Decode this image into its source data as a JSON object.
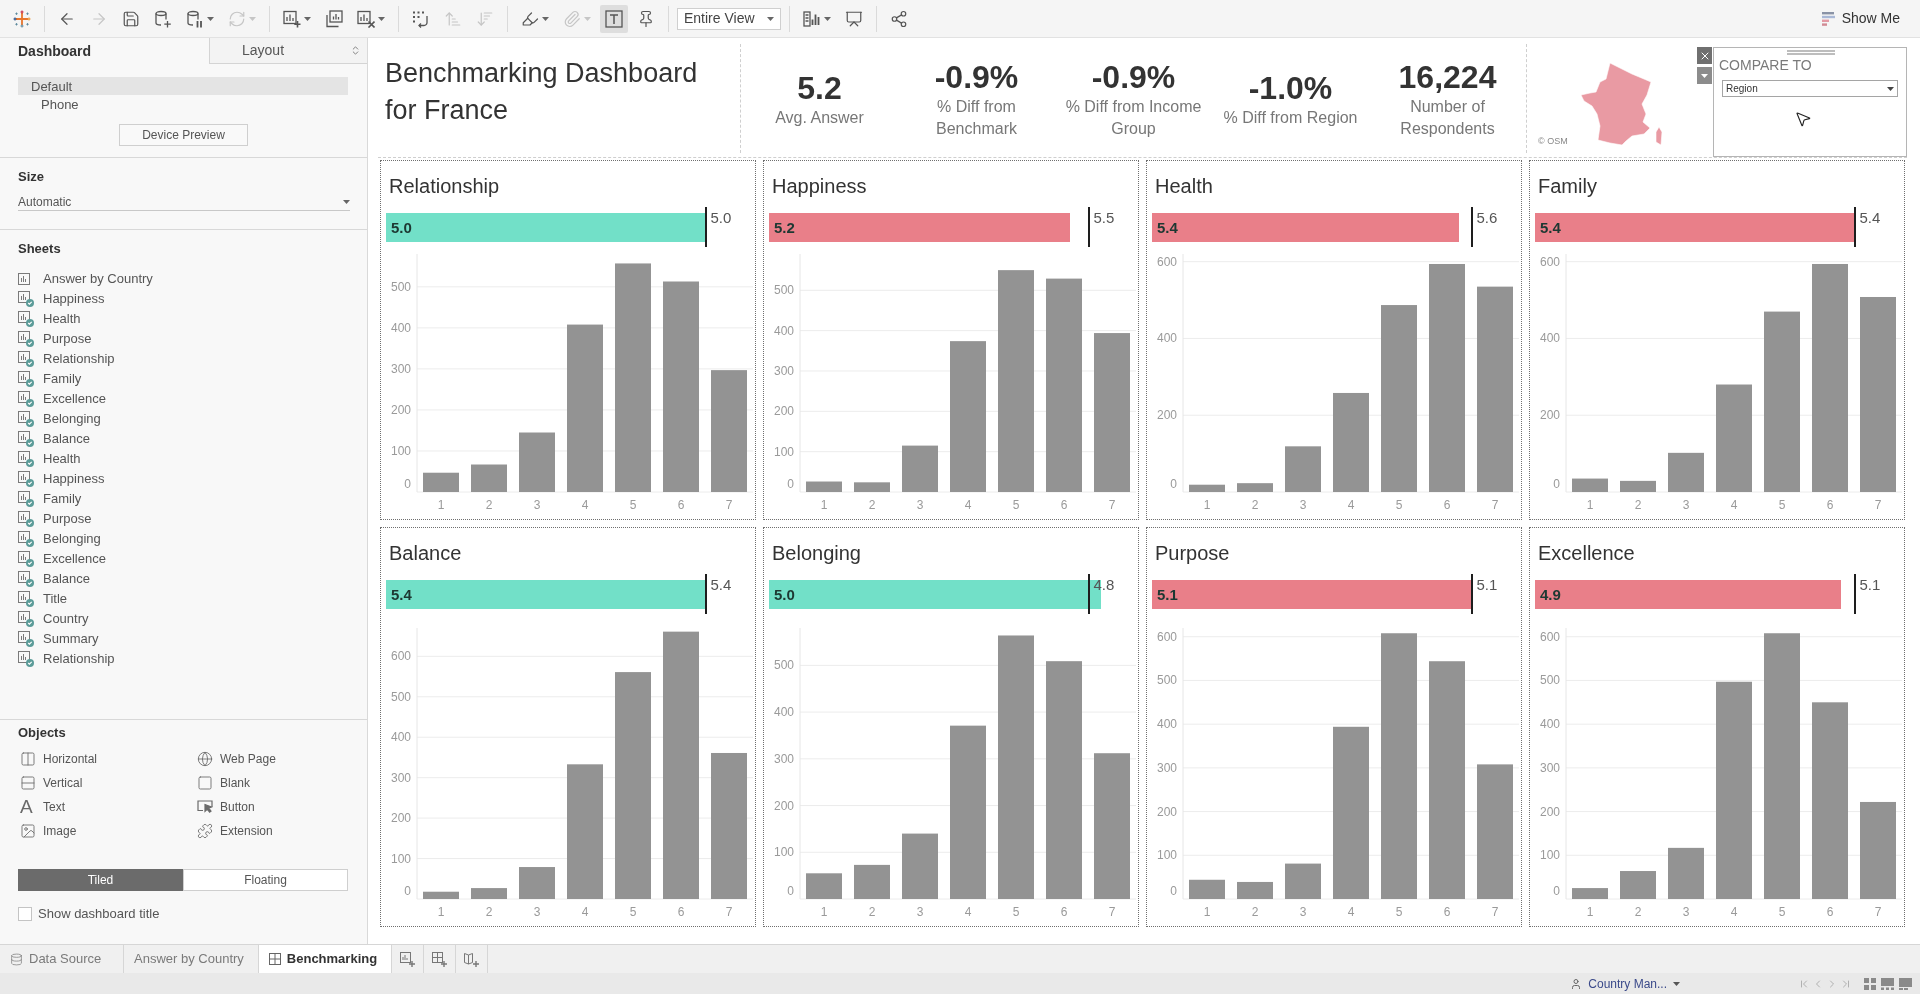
{
  "toolbar": {
    "groups": [
      [
        {
          "kind": "logo",
          "disabled": false,
          "selected": false,
          "menu": false
        }
      ],
      [
        {
          "kind": "back",
          "disabled": false,
          "selected": false,
          "menu": false
        },
        {
          "kind": "forward",
          "disabled": true,
          "selected": false,
          "menu": false
        },
        {
          "kind": "save",
          "disabled": false,
          "selected": false,
          "menu": false
        },
        {
          "kind": "new_data_source",
          "disabled": false,
          "selected": false,
          "menu": false
        },
        {
          "kind": "pause_updates",
          "disabled": false,
          "selected": false,
          "menu": true
        },
        {
          "kind": "refresh",
          "disabled": true,
          "selected": false,
          "menu": true
        }
      ],
      [
        {
          "kind": "new_worksheet",
          "disabled": false,
          "selected": false,
          "menu": true
        },
        {
          "kind": "duplicate",
          "disabled": false,
          "selected": false,
          "menu": false
        },
        {
          "kind": "clear",
          "disabled": false,
          "selected": false,
          "menu": true
        }
      ],
      [
        {
          "kind": "swap",
          "disabled": false,
          "selected": false,
          "menu": false
        },
        {
          "kind": "sort_ascending",
          "disabled": true,
          "selected": false,
          "menu": false
        },
        {
          "kind": "sort_descending",
          "disabled": true,
          "selected": false,
          "menu": false
        }
      ],
      [
        {
          "kind": "highlight",
          "disabled": false,
          "selected": false,
          "menu": true
        },
        {
          "kind": "attach",
          "disabled": true,
          "selected": false,
          "menu": true
        },
        {
          "kind": "mark_labels",
          "disabled": false,
          "selected": true,
          "menu": false
        },
        {
          "kind": "pin",
          "disabled": false,
          "selected": false,
          "menu": false
        }
      ],
      [
        {
          "kind": "view_select",
          "value": "Entire View",
          "disabled": false,
          "selected": false,
          "menu": true
        }
      ],
      [
        {
          "kind": "cards",
          "disabled": false,
          "selected": false,
          "menu": true
        },
        {
          "kind": "presentation",
          "disabled": false,
          "selected": false,
          "menu": false
        }
      ],
      [
        {
          "kind": "share",
          "disabled": false,
          "selected": false,
          "menu": false
        }
      ]
    ],
    "show_me": "Show Me"
  },
  "sidebar": {
    "tabs": [
      {
        "label": "Dashboard",
        "selected": true
      },
      {
        "label": "Layout",
        "selected": false
      }
    ],
    "devices": [
      {
        "label": "Default",
        "selected": true,
        "children": [
          {
            "label": "Phone",
            "selected": false
          }
        ]
      }
    ],
    "device_preview_button": "Device Preview",
    "size": {
      "heading": "Size",
      "value": "Automatic"
    },
    "sheets": {
      "heading": "Sheets",
      "items": [
        {
          "label": "Answer by Country",
          "in_dashboard": false
        },
        {
          "label": "Happiness",
          "in_dashboard": true
        },
        {
          "label": "Health",
          "in_dashboard": true
        },
        {
          "label": "Purpose",
          "in_dashboard": true
        },
        {
          "label": "Relationship",
          "in_dashboard": true
        },
        {
          "label": "Family",
          "in_dashboard": true
        },
        {
          "label": "Excellence",
          "in_dashboard": true
        },
        {
          "label": "Belonging",
          "in_dashboard": true
        },
        {
          "label": "Balance",
          "in_dashboard": true
        },
        {
          "label": "Health",
          "in_dashboard": true
        },
        {
          "label": "Happiness",
          "in_dashboard": true
        },
        {
          "label": "Family",
          "in_dashboard": true
        },
        {
          "label": "Purpose",
          "in_dashboard": true
        },
        {
          "label": "Belonging",
          "in_dashboard": true
        },
        {
          "label": "Excellence",
          "in_dashboard": true
        },
        {
          "label": "Balance",
          "in_dashboard": true
        },
        {
          "label": "Title",
          "in_dashboard": true
        },
        {
          "label": "Country",
          "in_dashboard": true
        },
        {
          "label": "Summary",
          "in_dashboard": true
        },
        {
          "label": "Relationship",
          "in_dashboard": true
        }
      ]
    },
    "objects": {
      "heading": "Objects",
      "items": [
        {
          "kind": "horizontal",
          "label": "Horizontal"
        },
        {
          "kind": "web_page",
          "label": "Web Page"
        },
        {
          "kind": "vertical",
          "label": "Vertical"
        },
        {
          "kind": "blank",
          "label": "Blank"
        },
        {
          "kind": "text",
          "label": "Text",
          "glyph": "A"
        },
        {
          "kind": "button",
          "label": "Button"
        },
        {
          "kind": "image",
          "label": "Image"
        },
        {
          "kind": "extension",
          "label": "Extension"
        }
      ]
    },
    "layout_modes": [
      {
        "label": "Tiled",
        "selected": true
      },
      {
        "label": "Floating",
        "selected": false
      }
    ],
    "show_title": {
      "label": "Show dashboard title",
      "checked": false
    }
  },
  "dashboard": {
    "title": "Benchmarking Dashboard for France",
    "kpis": [
      {
        "value": "5.2",
        "label": "Avg. Answer"
      },
      {
        "value": "-0.9%",
        "label": "% Diff from Benchmark"
      },
      {
        "value": "-0.9%",
        "label": "% Diff from Income Group"
      },
      {
        "value": "-1.0%",
        "label": "% Diff from Region"
      },
      {
        "value": "16,224",
        "label": "Number of Respondents"
      }
    ],
    "map": {
      "credit": "© OSM"
    },
    "compare_to": {
      "label": "COMPARE TO",
      "value": "Region"
    },
    "panels": [
      {
        "title": "Relationship",
        "score": "5.0",
        "benchmark": "5.0",
        "level": 0.875,
        "color": "#72e0c8",
        "chart_data": {
          "type": "bar",
          "categories": [
            "1",
            "2",
            "3",
            "4",
            "5",
            "6",
            "7"
          ],
          "values": [
            47,
            67,
            145,
            408,
            557,
            513,
            297
          ],
          "color": "#939393",
          "yticks": [
            0,
            100,
            200,
            300,
            400,
            500
          ],
          "ylim": [
            0,
            580
          ],
          "grid": true
        }
      },
      {
        "title": "Happiness",
        "score": "5.2",
        "benchmark": "5.5",
        "level": 0.827,
        "color": "#e97f89",
        "chart_data": {
          "type": "bar",
          "categories": [
            "1",
            "2",
            "3",
            "4",
            "5",
            "6",
            "7"
          ],
          "values": [
            26,
            24,
            115,
            374,
            550,
            529,
            394
          ],
          "color": "#939393",
          "yticks": [
            0,
            100,
            200,
            300,
            400,
            500
          ],
          "ylim": [
            0,
            590
          ],
          "grid": true
        }
      },
      {
        "title": "Health",
        "score": "5.4",
        "benchmark": "5.6",
        "level": 0.844,
        "color": "#e97f89",
        "chart_data": {
          "type": "bar",
          "categories": [
            "1",
            "2",
            "3",
            "4",
            "5",
            "6",
            "7"
          ],
          "values": [
            19,
            23,
            119,
            258,
            487,
            594,
            535
          ],
          "color": "#939393",
          "yticks": [
            0,
            200,
            400,
            600
          ],
          "ylim": [
            0,
            620
          ],
          "grid": true
        }
      },
      {
        "title": "Family",
        "score": "5.4",
        "benchmark": "5.4",
        "level": 0.875,
        "color": "#e97f89",
        "chart_data": {
          "type": "bar",
          "categories": [
            "1",
            "2",
            "3",
            "4",
            "5",
            "6",
            "7"
          ],
          "values": [
            35,
            29,
            102,
            280,
            470,
            594,
            508
          ],
          "color": "#939393",
          "yticks": [
            0,
            200,
            400,
            600
          ],
          "ylim": [
            0,
            620
          ],
          "grid": true
        }
      },
      {
        "title": "Balance",
        "score": "5.4",
        "benchmark": "5.4",
        "level": 0.875,
        "color": "#72e0c8",
        "chart_data": {
          "type": "bar",
          "categories": [
            "1",
            "2",
            "3",
            "4",
            "5",
            "6",
            "7"
          ],
          "values": [
            18,
            27,
            79,
            333,
            561,
            661,
            361
          ],
          "color": "#939393",
          "yticks": [
            0,
            100,
            200,
            300,
            400,
            500,
            600
          ],
          "ylim": [
            0,
            670
          ],
          "grid": true
        }
      },
      {
        "title": "Belonging",
        "score": "5.0",
        "benchmark": "4.8",
        "level": 0.911,
        "color": "#72e0c8",
        "chart_data": {
          "type": "bar",
          "categories": [
            "1",
            "2",
            "3",
            "4",
            "5",
            "6",
            "7"
          ],
          "values": [
            55,
            73,
            140,
            371,
            564,
            509,
            312
          ],
          "color": "#939393",
          "yticks": [
            0,
            100,
            200,
            300,
            400,
            500
          ],
          "ylim": [
            0,
            580
          ],
          "grid": true
        }
      },
      {
        "title": "Purpose",
        "score": "5.1",
        "benchmark": "5.1",
        "level": 0.875,
        "color": "#e97f89",
        "chart_data": {
          "type": "bar",
          "categories": [
            "1",
            "2",
            "3",
            "4",
            "5",
            "6",
            "7"
          ],
          "values": [
            44,
            39,
            81,
            394,
            608,
            544,
            308
          ],
          "color": "#939393",
          "yticks": [
            0,
            100,
            200,
            300,
            400,
            500,
            600
          ],
          "ylim": [
            0,
            620
          ],
          "grid": true
        }
      },
      {
        "title": "Excellence",
        "score": "4.9",
        "benchmark": "5.1",
        "level": 0.841,
        "color": "#e97f89",
        "chart_data": {
          "type": "bar",
          "categories": [
            "1",
            "2",
            "3",
            "4",
            "5",
            "6",
            "7"
          ],
          "values": [
            25,
            64,
            117,
            497,
            608,
            450,
            222
          ],
          "color": "#939393",
          "yticks": [
            0,
            100,
            200,
            300,
            400,
            500,
            600
          ],
          "ylim": [
            0,
            620
          ],
          "grid": true
        }
      }
    ]
  },
  "sheet_tabs": [
    {
      "kind": "data_source",
      "label": "Data Source",
      "selected": false
    },
    {
      "kind": "sheet",
      "label": "Answer by Country",
      "selected": false
    },
    {
      "kind": "dashboard",
      "label": "Benchmarking",
      "selected": true
    }
  ],
  "status_bar": {
    "user": "Country Man..."
  }
}
